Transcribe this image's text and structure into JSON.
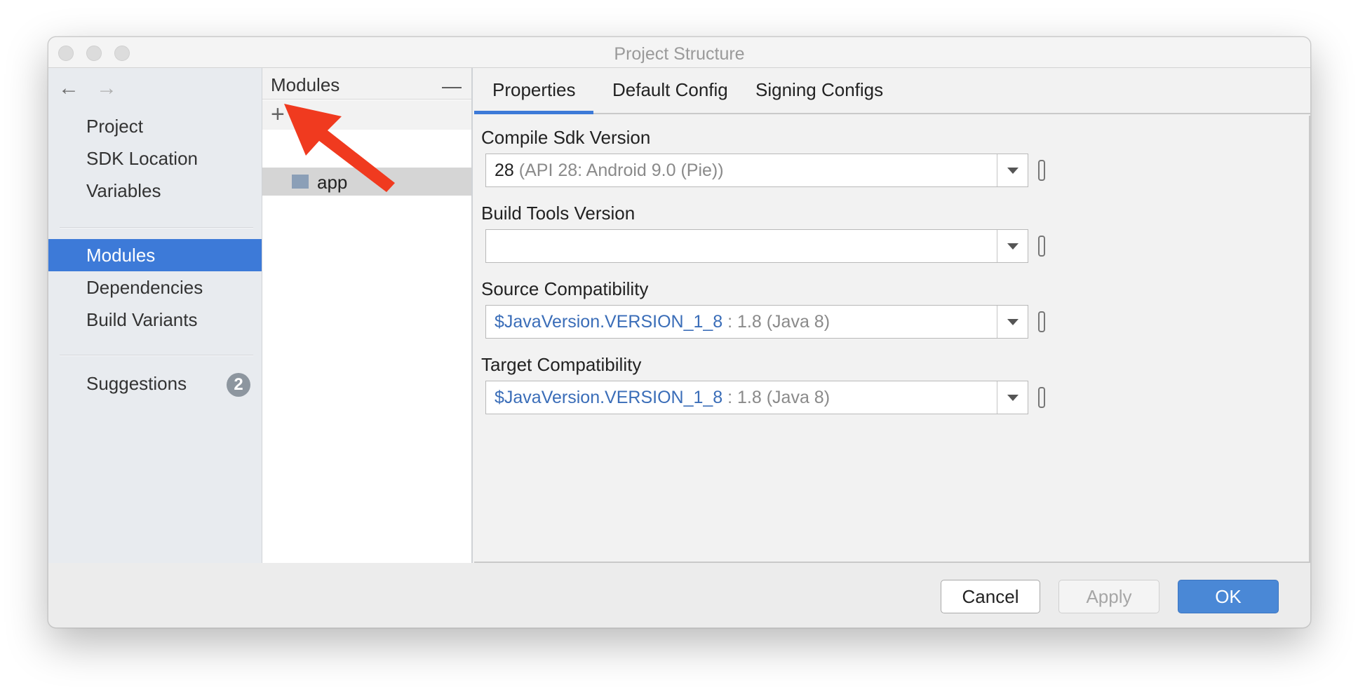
{
  "window": {
    "title": "Project Structure"
  },
  "sidebar": {
    "back_arrow": "←",
    "forward_arrow": "→",
    "items": [
      {
        "label": "Project"
      },
      {
        "label": "SDK Location"
      },
      {
        "label": "Variables"
      },
      {
        "label": "Modules",
        "active": true
      },
      {
        "label": "Dependencies"
      },
      {
        "label": "Build Variants"
      },
      {
        "label": "Suggestions",
        "badge": "2"
      }
    ]
  },
  "modules_panel": {
    "title": "Modules",
    "collapse_glyph": "—",
    "add_glyph": "+",
    "remove_glyph": "−",
    "items": [
      {
        "label": "app"
      }
    ]
  },
  "tabs": [
    {
      "label": "Properties",
      "active": true
    },
    {
      "label": "Default Config"
    },
    {
      "label": "Signing Configs"
    }
  ],
  "properties": {
    "compile_sdk": {
      "label": "Compile Sdk Version",
      "value": "28",
      "hint": "(API 28: Android 9.0 (Pie))"
    },
    "build_tools": {
      "label": "Build Tools Version",
      "value": ""
    },
    "source_compat": {
      "label": "Source Compatibility",
      "value": "$JavaVersion.VERSION_1_8",
      "hint": ": 1.8 (Java 8)"
    },
    "target_compat": {
      "label": "Target Compatibility",
      "value": "$JavaVersion.VERSION_1_8",
      "hint": ": 1.8 (Java 8)"
    }
  },
  "footer": {
    "cancel": "Cancel",
    "apply": "Apply",
    "ok": "OK"
  },
  "colors": {
    "accent": "#3d7ad8",
    "annotation_arrow": "#f03a1f"
  },
  "icons": [
    "back-arrow-icon",
    "forward-arrow-icon",
    "add-icon",
    "remove-icon",
    "module-folder-icon",
    "dropdown-arrow-icon"
  ]
}
